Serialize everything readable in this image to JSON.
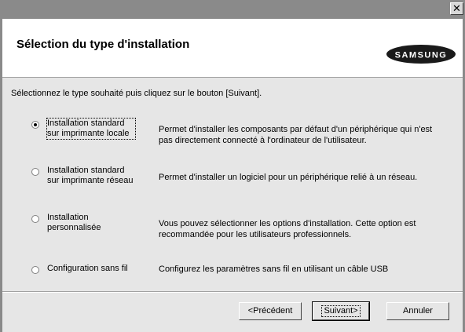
{
  "window": {
    "close_label": "✕"
  },
  "header": {
    "title": "Sélection du type d'installation",
    "brand": "SAMSUNG"
  },
  "instruction": "Sélectionnez le type souhaité puis cliquez sur le bouton [Suivant].",
  "options": [
    {
      "label_l1": "Installation standard",
      "label_l2": "sur imprimante locale",
      "checked": true,
      "desc_l1": "Permet d'installer les composants par défaut d'un périphérique qui n'est",
      "desc_l2": "pas directement connecté à l'ordinateur de l'utilisateur."
    },
    {
      "label_l1": "Installation standard",
      "label_l2": "sur imprimante réseau",
      "checked": false,
      "desc_l1": "Permet d'installer un logiciel pour un périphérique relié à un réseau.",
      "desc_l2": ""
    },
    {
      "label_l1": "Installation",
      "label_l2": "personnalisée",
      "checked": false,
      "desc_l1": "Vous pouvez sélectionner les options d'installation. Cette option est",
      "desc_l2": "recommandée pour les utilisateurs professionnels."
    },
    {
      "label_l1": "Configuration sans fil",
      "label_l2": "",
      "checked": false,
      "desc_l1": "Configurez les paramètres sans fil en utilisant un câble USB",
      "desc_l2": ""
    }
  ],
  "buttons": {
    "back": "<Précédent",
    "next": "Suivant>",
    "cancel": "Annuler"
  }
}
